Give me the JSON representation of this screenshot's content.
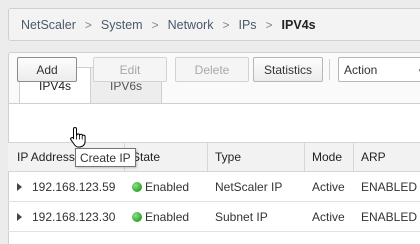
{
  "breadcrumb": {
    "items": [
      "NetScaler",
      "System",
      "Network",
      "IPs"
    ],
    "current": "IPV4s",
    "separator": ">"
  },
  "tabs": [
    {
      "label": "IPV4s",
      "active": true
    },
    {
      "label": "IPV6s",
      "active": false
    }
  ],
  "toolbar": {
    "add_label": "Add",
    "edit_label": "Edit",
    "delete_label": "Delete",
    "statistics_label": "Statistics",
    "action_label": "Action"
  },
  "tooltip": {
    "text": "Create IP"
  },
  "table": {
    "columns": [
      "IP Address",
      "State",
      "Type",
      "Mode",
      "ARP"
    ],
    "rows": [
      {
        "ip": "192.168.123.59",
        "state": "Enabled",
        "type": "NetScaler IP",
        "mode": "Active",
        "arp": "ENABLED"
      },
      {
        "ip": "192.168.123.30",
        "state": "Enabled",
        "type": "Subnet IP",
        "mode": "Active",
        "arp": "ENABLED"
      }
    ]
  },
  "colors": {
    "enabled_status": "#2aa52a"
  }
}
